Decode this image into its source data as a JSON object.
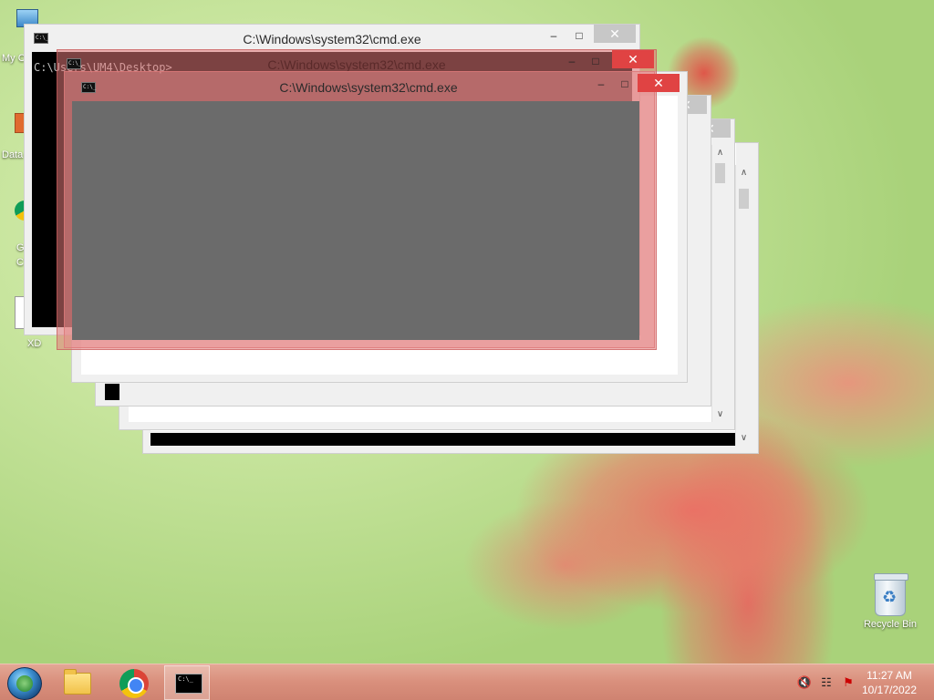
{
  "desktop": {
    "icons": [
      {
        "label": "My C"
      },
      {
        "label": "Data"
      },
      {
        "label": "G"
      },
      {
        "label": "C"
      },
      {
        "label": "XD"
      },
      {
        "label": "Recycle Bin"
      }
    ]
  },
  "windows": {
    "back": {
      "title": "C:\\Windows\\system32\\cmd.exe",
      "console_text": "C:\\Users\\UM4\\Desktop>"
    },
    "middle": {
      "title": "C:\\Windows\\system32\\cmd.exe"
    },
    "front": {
      "title": "C:\\Windows\\system32\\cmd.exe"
    },
    "controls": {
      "minimize": "–",
      "maximize": "□",
      "close": "✕"
    },
    "icon_text": "C:\\_"
  },
  "taskbar": {
    "apps": [
      {
        "name": "start-button"
      },
      {
        "name": "file-explorer"
      },
      {
        "name": "google-chrome"
      },
      {
        "name": "command-prompt",
        "icon_text": "C:\\_"
      }
    ],
    "clock": {
      "time": "11:27 AM",
      "date": "10/17/2022"
    }
  },
  "colors": {
    "taskbar": "#d98f7c",
    "close_button_active": "#e04343",
    "close_button_inactive": "#c7c7c7"
  }
}
